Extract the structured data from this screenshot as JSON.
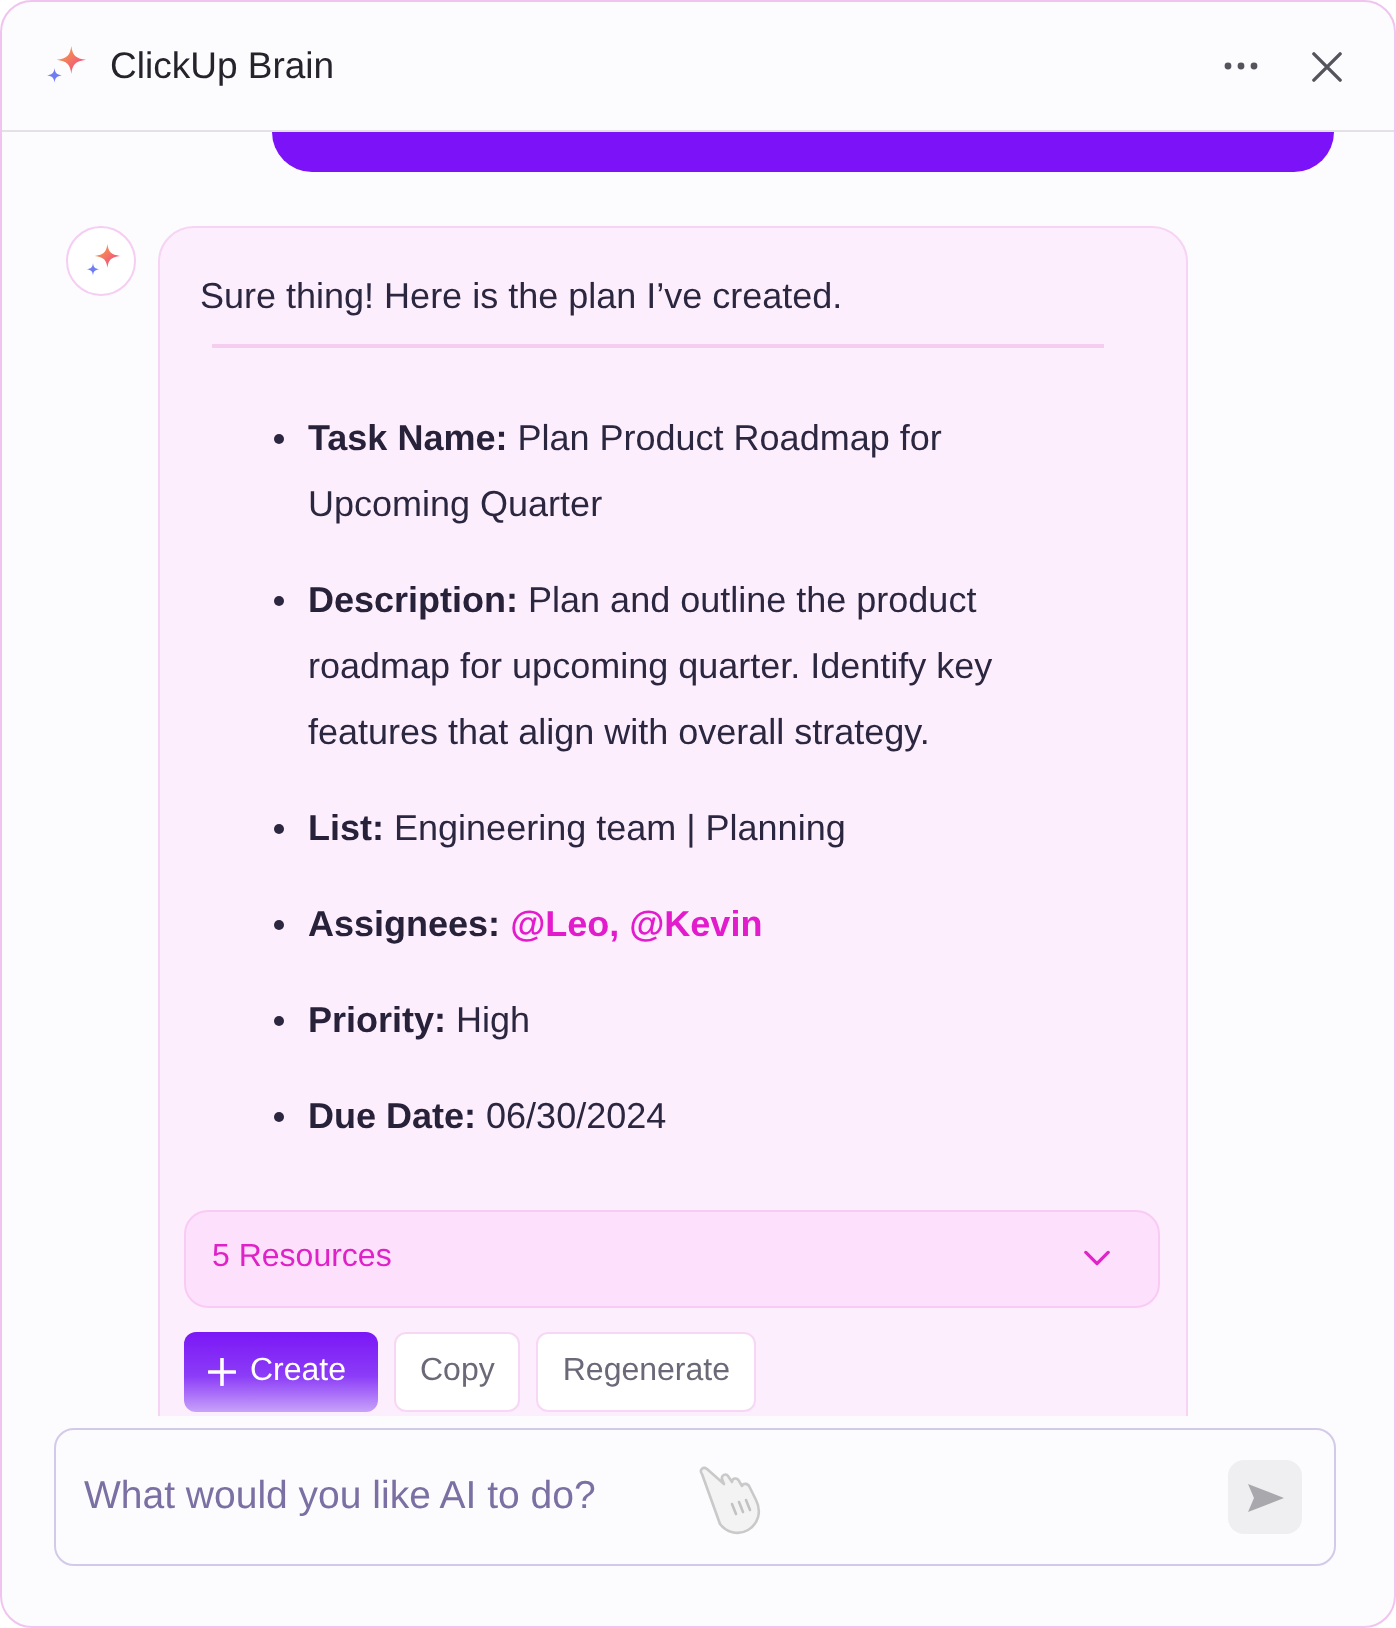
{
  "window": {
    "title": "ClickUp Brain"
  },
  "response": {
    "intro": "Sure thing! Here is the plan I’ve created.",
    "fields": [
      {
        "label": "Task Name:",
        "value": "Plan Product Roadmap for Upcoming Quarter",
        "kind": "text"
      },
      {
        "label": "Description:",
        "value": "Plan and outline the product roadmap for upcoming quarter. Identify key features that align with overall strategy.",
        "kind": "text"
      },
      {
        "label": "List:",
        "value": "Engineering team | Planning",
        "kind": "text"
      },
      {
        "label": "Assignees:",
        "value": "@Leo, @Kevin",
        "kind": "mention"
      },
      {
        "label": "Priority:",
        "value": "High",
        "kind": "text"
      },
      {
        "label": "Due Date:",
        "value": "06/30/2024",
        "kind": "text"
      }
    ],
    "resources": {
      "label": "5 Resources",
      "expanded": false
    },
    "actions": [
      {
        "label": "Create",
        "kind": "primary"
      },
      {
        "label": "Copy",
        "kind": "secondary"
      },
      {
        "label": "Regenerate",
        "kind": "secondary"
      }
    ]
  },
  "composer": {
    "placeholder": "What would you like AI to do?"
  }
}
